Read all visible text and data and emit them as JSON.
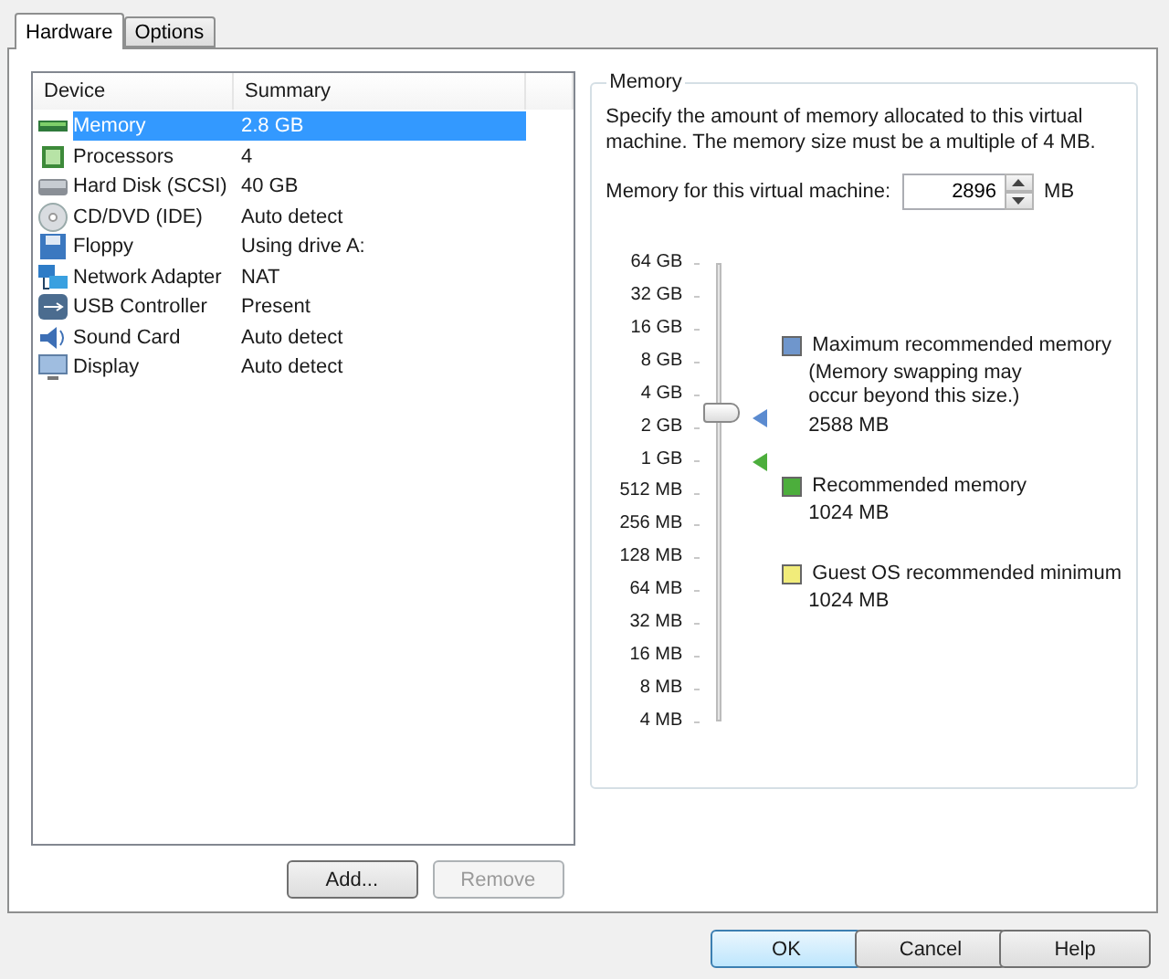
{
  "tabs": [
    {
      "label": "Hardware",
      "selected": true
    },
    {
      "label": "Options",
      "selected": false
    }
  ],
  "devices": {
    "columns": [
      "Device",
      "Summary"
    ],
    "rows": [
      {
        "kind": "memory",
        "device": "Memory",
        "summary": "2.8 GB",
        "selected": true
      },
      {
        "kind": "cpu",
        "device": "Processors",
        "summary": "4",
        "selected": false
      },
      {
        "kind": "disk",
        "device": "Hard Disk (SCSI)",
        "summary": "40 GB",
        "selected": false
      },
      {
        "kind": "cd",
        "device": "CD/DVD (IDE)",
        "summary": "Auto detect",
        "selected": false
      },
      {
        "kind": "floppy",
        "device": "Floppy",
        "summary": "Using drive A:",
        "selected": false
      },
      {
        "kind": "network",
        "device": "Network Adapter",
        "summary": "NAT",
        "selected": false
      },
      {
        "kind": "usb",
        "device": "USB Controller",
        "summary": "Present",
        "selected": false
      },
      {
        "kind": "sound",
        "device": "Sound Card",
        "summary": "Auto detect",
        "selected": false
      },
      {
        "kind": "display",
        "device": "Display",
        "summary": "Auto detect",
        "selected": false
      }
    ]
  },
  "list_buttons": [
    {
      "label": "Add...",
      "disabled": false
    },
    {
      "label": "Remove",
      "disabled": true
    }
  ],
  "memory": {
    "title": "Memory",
    "description": "Specify the amount of memory allocated to this virtual machine. The memory size must be a multiple of 4 MB.",
    "field_label": "Memory for this virtual machine:",
    "value": "2896",
    "unit": "MB",
    "slider": {
      "level": 0.677,
      "ticks": [
        "64 GB",
        "32 GB",
        "16 GB",
        "8 GB",
        "4 GB",
        "2 GB",
        "1 GB",
        "512 MB",
        "256 MB",
        "128 MB",
        "64 MB",
        "32 MB",
        "16 MB",
        "8 MB",
        "4 MB"
      ],
      "markers": [
        {
          "color": "#5b8bd0",
          "level": 0.667
        },
        {
          "color": "#4cae3c",
          "level": 0.571
        }
      ]
    },
    "legend": [
      {
        "color": "#6f96cc",
        "label": "Maximum recommended memory",
        "note": "(Memory swapping may occur beyond this size.)",
        "value": "2588 MB"
      },
      {
        "color": "#4cae3c",
        "label": "Recommended memory",
        "value": "1024 MB"
      },
      {
        "color": "#f1ec7a",
        "label": "Guest OS recommended minimum",
        "value": "1024 MB"
      }
    ]
  },
  "buttons": [
    {
      "label": "OK",
      "default": true
    },
    {
      "label": "Cancel",
      "default": false
    },
    {
      "label": "Help",
      "default": false
    }
  ]
}
